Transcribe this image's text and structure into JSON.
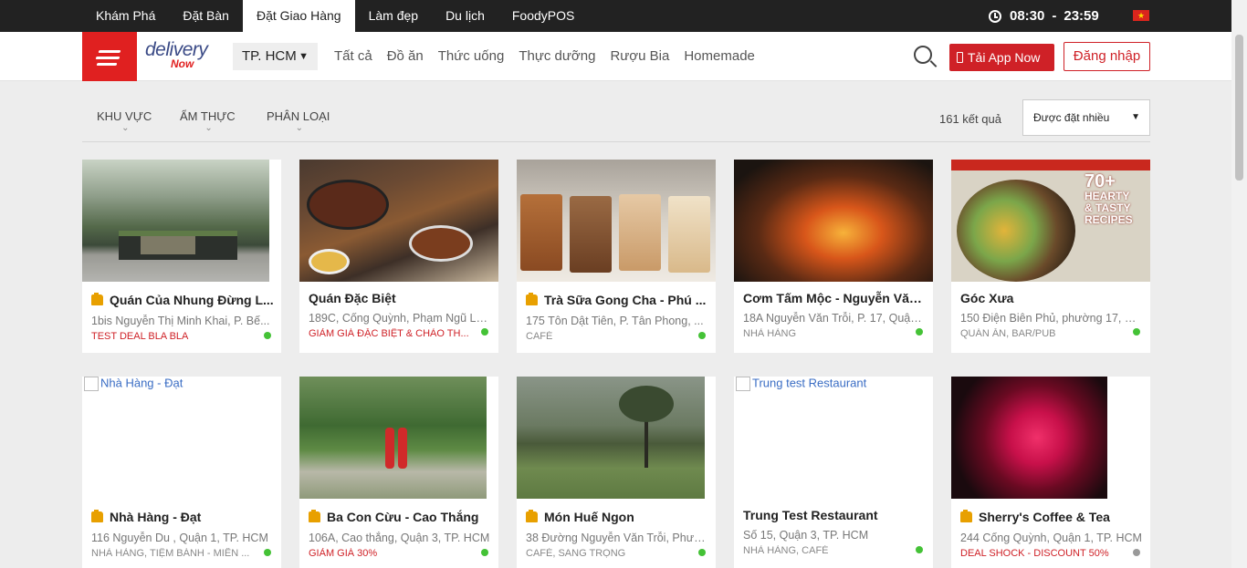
{
  "top_nav": {
    "items": [
      "Khám Phá",
      "Đặt Bàn",
      "Đặt Giao Hàng",
      "Làm đẹp",
      "Du lịch",
      "FoodyPOS"
    ],
    "active": "Đặt Giao Hàng"
  },
  "hours": {
    "open": "08:30",
    "separator": "-",
    "close": "23:59"
  },
  "header": {
    "logo_text": "delivery",
    "logo_sub": "Now",
    "city": "TP. HCM",
    "categories": [
      "Tất cả",
      "Đồ ăn",
      "Thức uống",
      "Thực dưỡng",
      "Rượu Bia",
      "Homemade"
    ],
    "app_button": "Tải App Now",
    "login_button": "Đăng nhập"
  },
  "filters": {
    "area": "KHU VỰC",
    "cuisine": "ẨM THỰC",
    "type": "PHÂN LOẠI",
    "result_count": "161 kết quả",
    "sort": "Được đặt nhiều"
  },
  "colors": {
    "brand_red": "#cf2127",
    "open_green": "#44c236",
    "closed_gray": "#999999",
    "top_bar": "#222222"
  },
  "cards": [
    {
      "name": "Quán Của Nhung Đừng L...",
      "address": "1bis Nguyễn Thị Minh Khai, P. Bế...",
      "tag": "TEST DEAL BLA BLA",
      "tag_type": "deal",
      "thumb": true,
      "status": "open",
      "image": "forest-house"
    },
    {
      "name": "Quán Đặc Biệt",
      "address": "189C, Cống Quỳnh, Phạm Ngũ Lã...",
      "tag": "GIẢM GIÁ ĐẶC BIỆT & CHÀO TH...",
      "tag_type": "deal",
      "thumb": false,
      "status": "open",
      "image": "bbq-table"
    },
    {
      "name": "Trà Sữa Gong Cha - Phú ...",
      "address": "175 Tôn Dật Tiên, P. Tân Phong, ...",
      "tag": "CAFÉ",
      "tag_type": "cat",
      "thumb": true,
      "status": "open",
      "image": "milk-tea-cups"
    },
    {
      "name": "Cơm Tấm Mộc - Nguyễn Văn ...",
      "address": "18A Nguyễn Văn Trỗi, P. 17, Quận...",
      "tag": "NHÀ HÀNG",
      "tag_type": "cat",
      "thumb": false,
      "status": "open",
      "image": "fire-dragon"
    },
    {
      "name": "Góc Xưa",
      "address": "150 Điện Biên Phủ, phường 17, Bì...",
      "tag": "QUÁN ĂN, BAR/PUB",
      "tag_type": "cat",
      "thumb": false,
      "status": "open",
      "image": "magazine-cover",
      "magazine_line1": "70+",
      "magazine_line2": "HEARTY",
      "magazine_line3": "& TASTY",
      "magazine_line4": "RECIPES"
    },
    {
      "name": "Nhà Hàng - Đạt",
      "address": "116 Nguyễn Du , Quận 1, TP. HCM",
      "tag": "NHÀ HÀNG, TIỆM BÁNH - MIỀN ...",
      "tag_type": "cat",
      "thumb": true,
      "status": "open",
      "image": "broken",
      "alt": "Nhà Hàng - Đạt"
    },
    {
      "name": "Ba Con Cừu - Cao Thắng",
      "address": "106A, Cao thắng, Quận 3, TP. HCM",
      "tag": "GIẢM GIÁ 30%",
      "tag_type": "deal",
      "thumb": true,
      "status": "open",
      "image": "park-couple"
    },
    {
      "name": "Món Huế Ngon",
      "address": "38 Đường Nguyễn Văn Trỗi, Phườ...",
      "tag": "CAFÉ, SANG TRỌNG",
      "tag_type": "cat",
      "thumb": true,
      "status": "open",
      "image": "misty-garden"
    },
    {
      "name": "Trung Test Restaurant",
      "address": "Số 15, Quận 3, TP. HCM",
      "tag": "NHÀ HÀNG, CAFÉ",
      "tag_type": "cat",
      "thumb": false,
      "status": "open",
      "image": "broken",
      "alt": "Trung test Restaurant"
    },
    {
      "name": "Sherry's Coffee & Tea",
      "address": "244 Cống Quỳnh, Quận 1, TP. HCM",
      "tag": "DEAL SHOCK - DISCOUNT 50%",
      "tag_type": "deal",
      "thumb": true,
      "status": "closed",
      "image": "red-rose"
    }
  ]
}
